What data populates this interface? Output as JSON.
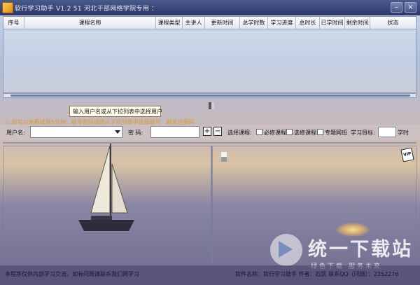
{
  "window": {
    "title": "软行学习助手 V1.2   51   河北干部网络学院专用  ：",
    "minimize_label": "–",
    "close_label": "×"
  },
  "table": {
    "columns": [
      "序号",
      "课程名称",
      "课程类型",
      "主讲人",
      "更新时间",
      "总学时数",
      "学习进度",
      "总时长",
      "已学时间",
      "剩余时间",
      "状态"
    ]
  },
  "tooltip": {
    "text": "输入用户名或从下拉列表中选择用户"
  },
  "notice": {
    "icon": "warning-icon",
    "text": "您可以免费试用5分钟：账号密码请您从下拉列表中选择账号 · 网关注册码 ·"
  },
  "form": {
    "username_label": "用户名:",
    "username_value": "",
    "password_label": "密  码:",
    "password_value": "",
    "add_label": "+",
    "remove_label": "−",
    "course_select_label": "选择课程:",
    "options": [
      "必修课程",
      "选修课程",
      "专题网班"
    ],
    "goal_label": "学习目标:",
    "goal_value": "",
    "goal_unit": "学时"
  },
  "vip_badge": "VIP",
  "watermark": {
    "big": "统一下载站",
    "small": "绿色下载  服务未来"
  },
  "statusbar": {
    "left": "本程序仅供内部学习交流，如有问题请联系我们网学习",
    "right": "软件名称：软行学习助手  作者：石凯  联系QQ（问题）：2352276"
  },
  "colors": {
    "titlebar": "#2c3766",
    "notice": "#d99a2e",
    "border": "#8d98b6"
  }
}
